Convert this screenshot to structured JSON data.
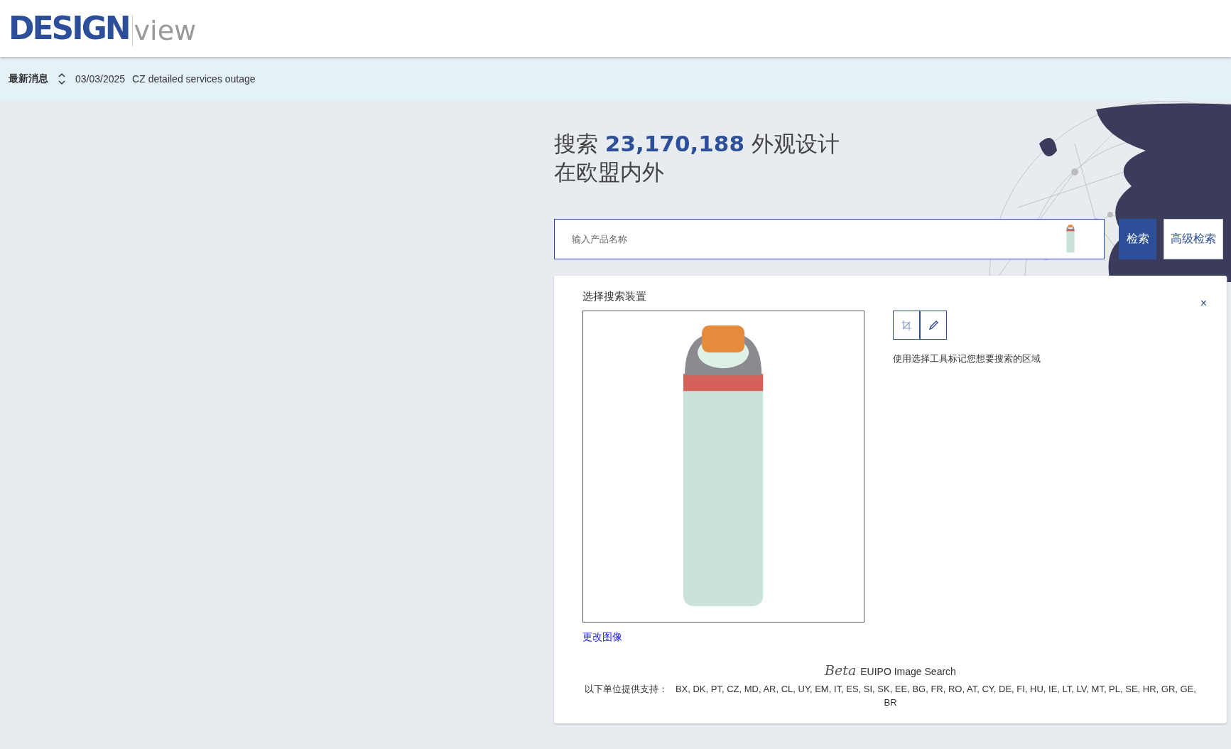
{
  "logo": {
    "brand": "DESIGN",
    "product": "view"
  },
  "news": {
    "label": "最新消息",
    "date": "03/03/2025",
    "text": "CZ detailed services outage"
  },
  "hero": {
    "title_line_1": "搜索 **23,170,188** 外观设计",
    "title_line_2": "在欧盟内外"
  },
  "search": {
    "placeholder": "输入产品名称",
    "search_button": "检索",
    "advanced_button": "高级检索"
  },
  "image_panel": {
    "title": "选择搜索装置",
    "close": "×",
    "tools": [
      {
        "kind": "crop",
        "selected": false
      },
      {
        "kind": "pencil",
        "selected": false
      }
    ],
    "hint": "使用选择工具标记您想要搜索的区域",
    "change_link": "更改图像",
    "beta": "Beta",
    "service": "EUIPO Image Search",
    "supporters_label": "以下单位提供支持：",
    "supporters": "BX, DK, PT, CZ, MD, AR, CL, UY, EM, IT, ES, SI, SK, EE, BG, FR, RO, AT, CY, DE, FI, HU, IE, LT, LV, MT, PL, SE, HR, GR, GE, BR"
  }
}
